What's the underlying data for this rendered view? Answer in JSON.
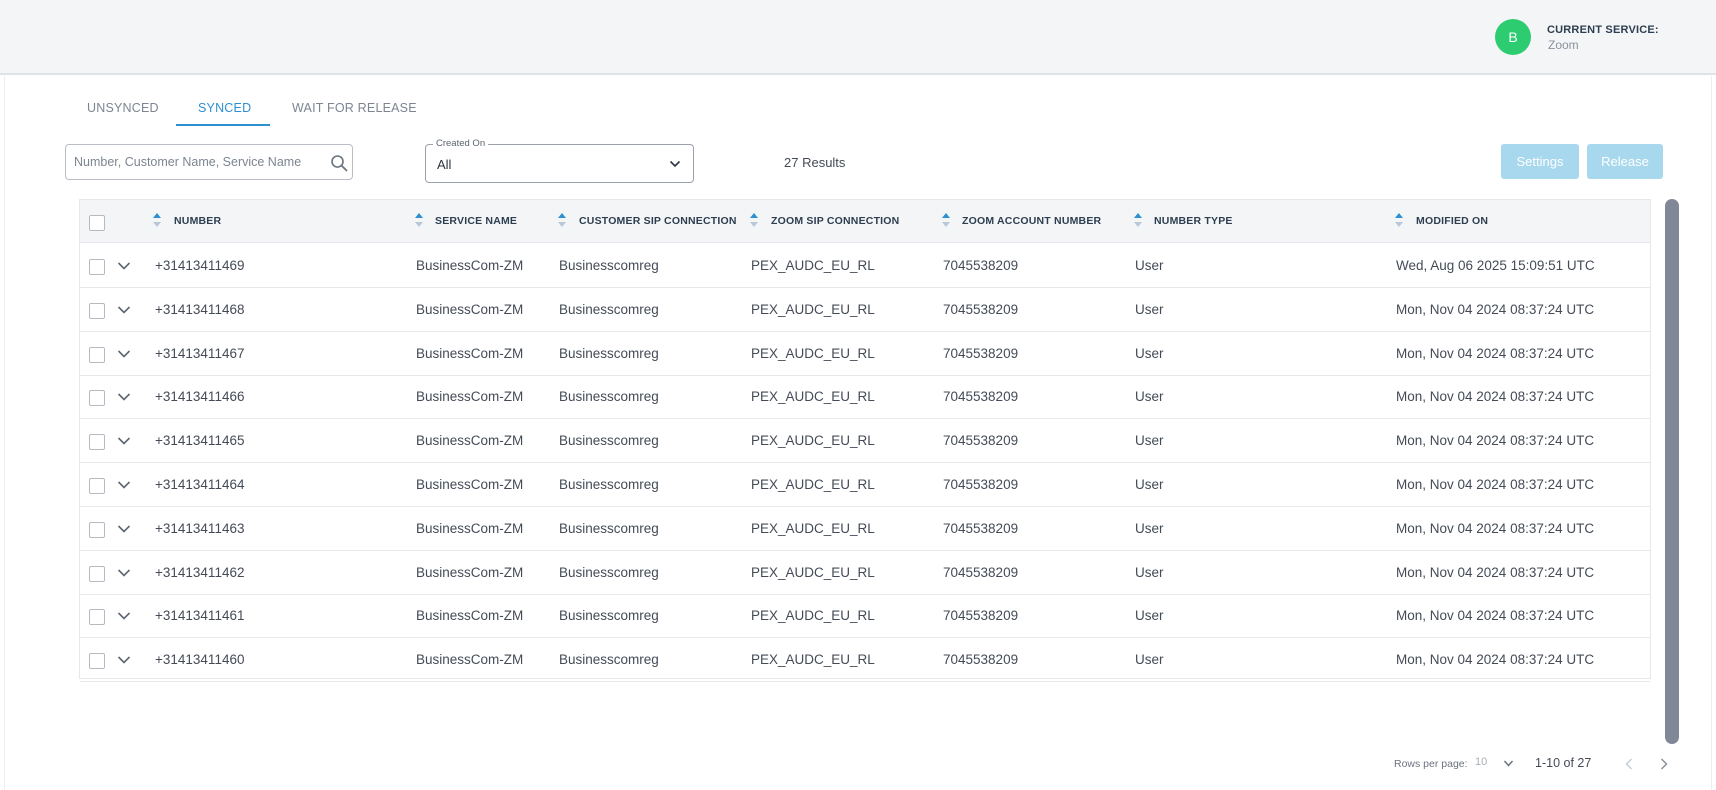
{
  "header": {
    "avatar_initial": "B",
    "current_service_label": "CURRENT SERVICE:",
    "current_service_value": "Zoom",
    "avatar_color": "#2ecc71"
  },
  "tabs": [
    {
      "label": "UNSYNCED",
      "active": false
    },
    {
      "label": "SYNCED",
      "active": true
    },
    {
      "label": "WAIT FOR RELEASE",
      "active": false
    }
  ],
  "toolbar": {
    "search_placeholder": "Number, Customer Name, Service Name",
    "search_value": "",
    "filter_label": "Created On",
    "filter_value": "All",
    "results_text": "27 Results",
    "settings_label": "Settings",
    "release_label": "Release",
    "accent_color": "#2e90d1",
    "button_color": "#a8d8ee"
  },
  "table": {
    "columns": [
      "NUMBER",
      "SERVICE NAME",
      "CUSTOMER SIP CONNECTION",
      "ZOOM SIP CONNECTION",
      "ZOOM ACCOUNT NUMBER",
      "NUMBER TYPE",
      "MODIFIED ON"
    ],
    "rows": [
      [
        "+31413411469",
        "BusinessCom-ZM",
        "Businesscomreg",
        "PEX_AUDC_EU_RL",
        "7045538209",
        "User",
        "Wed, Aug 06 2025 15:09:51 UTC"
      ],
      [
        "+31413411468",
        "BusinessCom-ZM",
        "Businesscomreg",
        "PEX_AUDC_EU_RL",
        "7045538209",
        "User",
        "Mon, Nov 04 2024 08:37:24 UTC"
      ],
      [
        "+31413411467",
        "BusinessCom-ZM",
        "Businesscomreg",
        "PEX_AUDC_EU_RL",
        "7045538209",
        "User",
        "Mon, Nov 04 2024 08:37:24 UTC"
      ],
      [
        "+31413411466",
        "BusinessCom-ZM",
        "Businesscomreg",
        "PEX_AUDC_EU_RL",
        "7045538209",
        "User",
        "Mon, Nov 04 2024 08:37:24 UTC"
      ],
      [
        "+31413411465",
        "BusinessCom-ZM",
        "Businesscomreg",
        "PEX_AUDC_EU_RL",
        "7045538209",
        "User",
        "Mon, Nov 04 2024 08:37:24 UTC"
      ],
      [
        "+31413411464",
        "BusinessCom-ZM",
        "Businesscomreg",
        "PEX_AUDC_EU_RL",
        "7045538209",
        "User",
        "Mon, Nov 04 2024 08:37:24 UTC"
      ],
      [
        "+31413411463",
        "BusinessCom-ZM",
        "Businesscomreg",
        "PEX_AUDC_EU_RL",
        "7045538209",
        "User",
        "Mon, Nov 04 2024 08:37:24 UTC"
      ],
      [
        "+31413411462",
        "BusinessCom-ZM",
        "Businesscomreg",
        "PEX_AUDC_EU_RL",
        "7045538209",
        "User",
        "Mon, Nov 04 2024 08:37:24 UTC"
      ],
      [
        "+31413411461",
        "BusinessCom-ZM",
        "Businesscomreg",
        "PEX_AUDC_EU_RL",
        "7045538209",
        "User",
        "Mon, Nov 04 2024 08:37:24 UTC"
      ],
      [
        "+31413411460",
        "BusinessCom-ZM",
        "Businesscomreg",
        "PEX_AUDC_EU_RL",
        "7045538209",
        "User",
        "Mon, Nov 04 2024 08:37:24 UTC"
      ]
    ]
  },
  "pagination": {
    "rows_per_page_label": "Rows per page:",
    "rows_per_page_value": "10",
    "page_info": "1-10 of 27"
  },
  "icons": {
    "search": "search-icon",
    "filter_dropdown": "chevron-down-icon",
    "row_expand": "chevron-down-icon",
    "sort": "sort-arrows-icon",
    "prev": "chevron-left-icon",
    "next": "chevron-right-icon"
  }
}
